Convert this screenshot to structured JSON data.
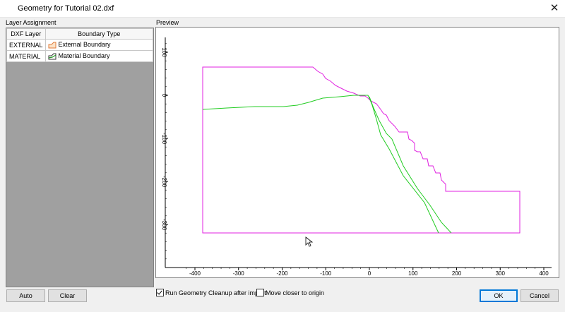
{
  "window": {
    "title": "Geometry for Tutorial 02.dxf",
    "close_symbol": "✕"
  },
  "layer_assignment": {
    "label": "Layer Assignment",
    "columns": [
      "DXF Layer",
      "Boundary Type"
    ],
    "rows": [
      {
        "layer": "EXTERNAL",
        "boundary": "External Boundary",
        "icon": "external-boundary-icon",
        "icon_color": "#e07b39"
      },
      {
        "layer": "MATERIAL",
        "boundary": "Material Boundary",
        "icon": "material-boundary-icon",
        "icon_color": "#2a9d2a"
      }
    ]
  },
  "preview": {
    "label": "Preview",
    "x_ticks": [
      "-400",
      "-300",
      "-200",
      "-100",
      "0",
      "100",
      "200",
      "300",
      "400"
    ],
    "y_ticks": [
      "100",
      "0",
      "-100",
      "-200",
      "-300"
    ],
    "colors": {
      "external": "#e020e0",
      "material": "#22cc22",
      "axis": "#000000"
    }
  },
  "buttons": {
    "auto": "Auto",
    "clear": "Clear",
    "ok": "OK",
    "cancel": "Cancel"
  },
  "options": {
    "run_cleanup": {
      "label": "Run Geometry Cleanup after import",
      "checked": true
    },
    "move_closer": {
      "label": "Move closer to origin",
      "checked": false
    }
  }
}
